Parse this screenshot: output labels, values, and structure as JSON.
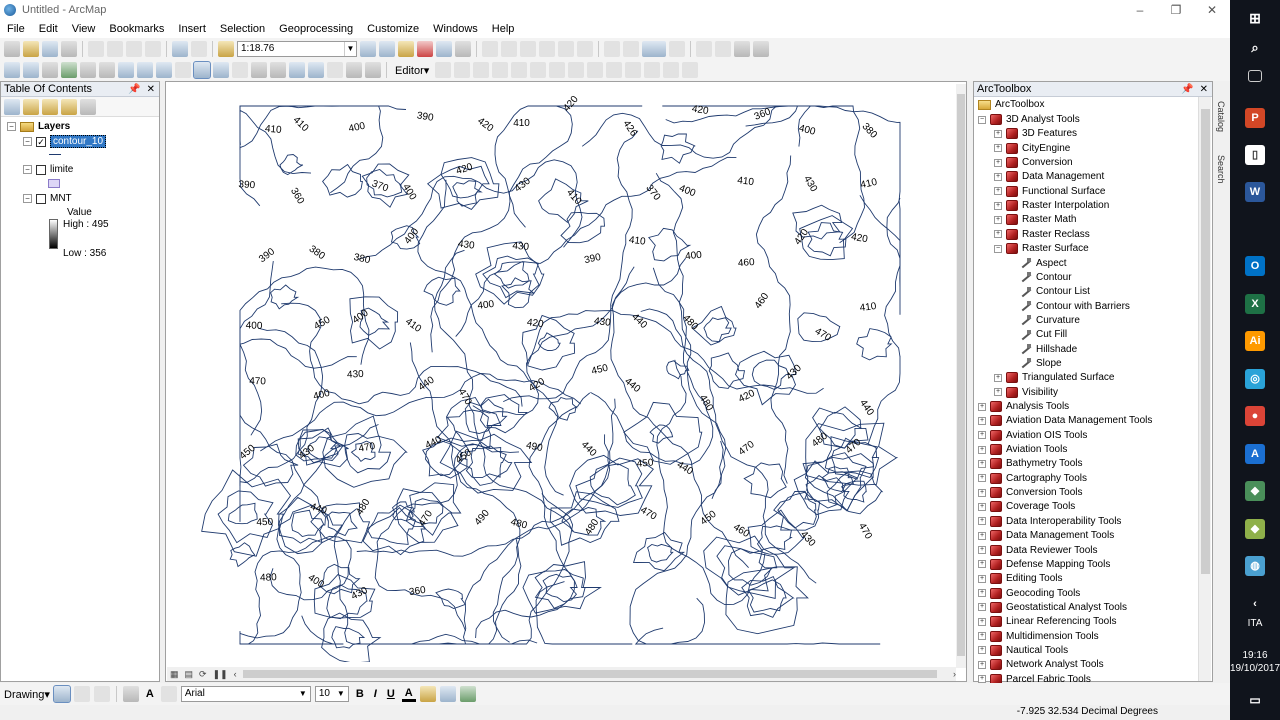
{
  "window": {
    "title": "Untitled - ArcMap",
    "minimize": "–",
    "maximize": "❐",
    "close": "✕"
  },
  "menu": [
    "File",
    "Edit",
    "View",
    "Bookmarks",
    "Insert",
    "Selection",
    "Geoprocessing",
    "Customize",
    "Windows",
    "Help"
  ],
  "toolbar": {
    "scale": "1:18.76",
    "editor_label": "Editor▾"
  },
  "toc": {
    "title": "Table Of Contents",
    "layers_label": "Layers",
    "items": [
      {
        "name": "contour_10",
        "checked": true
      },
      {
        "name": "limite",
        "checked": false
      },
      {
        "name": "MNT",
        "checked": false
      }
    ],
    "mnt_value_label": "Value",
    "mnt_high": "High : 495",
    "mnt_low": "Low : 356"
  },
  "map": {
    "contour_color": "#1f3a6e",
    "labels": [
      "410",
      "410",
      "400",
      "390",
      "420",
      "410",
      "420",
      "426",
      "420",
      "360",
      "400",
      "380",
      "390",
      "360",
      "370",
      "400",
      "420",
      "430",
      "410",
      "370",
      "400",
      "410",
      "430",
      "410",
      "390",
      "380",
      "380",
      "400",
      "430",
      "430",
      "390",
      "410",
      "400",
      "460",
      "420",
      "420",
      "400",
      "450",
      "400",
      "410",
      "400",
      "420",
      "430",
      "440",
      "480",
      "460",
      "470",
      "410",
      "470",
      "400",
      "430",
      "440",
      "470",
      "420",
      "450",
      "440",
      "480",
      "420",
      "430",
      "440",
      "450",
      "430",
      "470",
      "440",
      "450",
      "490",
      "440",
      "450",
      "440",
      "470",
      "480",
      "470",
      "450",
      "440",
      "480",
      "470",
      "490",
      "480",
      "480",
      "470",
      "450",
      "460",
      "430",
      "470",
      "480",
      "400",
      "430",
      "360"
    ]
  },
  "toolbox": {
    "title": "ArcToolbox",
    "root": "ArcToolbox",
    "items": [
      {
        "label": "3D Analyst Tools",
        "level": 1,
        "kind": "toolbox",
        "expanded": true
      },
      {
        "label": "3D Features",
        "level": 2,
        "kind": "toolbox",
        "expanded": false
      },
      {
        "label": "CityEngine",
        "level": 2,
        "kind": "toolbox",
        "expanded": false
      },
      {
        "label": "Conversion",
        "level": 2,
        "kind": "toolbox",
        "expanded": false
      },
      {
        "label": "Data Management",
        "level": 2,
        "kind": "toolbox",
        "expanded": false
      },
      {
        "label": "Functional Surface",
        "level": 2,
        "kind": "toolbox",
        "expanded": false
      },
      {
        "label": "Raster Interpolation",
        "level": 2,
        "kind": "toolbox",
        "expanded": false
      },
      {
        "label": "Raster Math",
        "level": 2,
        "kind": "toolbox",
        "expanded": false
      },
      {
        "label": "Raster Reclass",
        "level": 2,
        "kind": "toolbox",
        "expanded": false
      },
      {
        "label": "Raster Surface",
        "level": 2,
        "kind": "toolbox",
        "expanded": true
      },
      {
        "label": "Aspect",
        "level": 3,
        "kind": "tool"
      },
      {
        "label": "Contour",
        "level": 3,
        "kind": "tool"
      },
      {
        "label": "Contour List",
        "level": 3,
        "kind": "tool"
      },
      {
        "label": "Contour with Barriers",
        "level": 3,
        "kind": "tool"
      },
      {
        "label": "Curvature",
        "level": 3,
        "kind": "tool"
      },
      {
        "label": "Cut Fill",
        "level": 3,
        "kind": "tool"
      },
      {
        "label": "Hillshade",
        "level": 3,
        "kind": "tool"
      },
      {
        "label": "Slope",
        "level": 3,
        "kind": "tool"
      },
      {
        "label": "Triangulated Surface",
        "level": 2,
        "kind": "toolbox",
        "expanded": false
      },
      {
        "label": "Visibility",
        "level": 2,
        "kind": "toolbox",
        "expanded": false
      },
      {
        "label": "Analysis Tools",
        "level": 1,
        "kind": "toolbox",
        "expanded": false
      },
      {
        "label": "Aviation Data Management Tools",
        "level": 1,
        "kind": "toolbox",
        "expanded": false
      },
      {
        "label": "Aviation OIS Tools",
        "level": 1,
        "kind": "toolbox",
        "expanded": false
      },
      {
        "label": "Aviation Tools",
        "level": 1,
        "kind": "toolbox",
        "expanded": false
      },
      {
        "label": "Bathymetry Tools",
        "level": 1,
        "kind": "toolbox",
        "expanded": false
      },
      {
        "label": "Cartography Tools",
        "level": 1,
        "kind": "toolbox",
        "expanded": false
      },
      {
        "label": "Conversion Tools",
        "level": 1,
        "kind": "toolbox",
        "expanded": false
      },
      {
        "label": "Coverage Tools",
        "level": 1,
        "kind": "toolbox",
        "expanded": false
      },
      {
        "label": "Data Interoperability Tools",
        "level": 1,
        "kind": "toolbox",
        "expanded": false
      },
      {
        "label": "Data Management Tools",
        "level": 1,
        "kind": "toolbox",
        "expanded": false
      },
      {
        "label": "Data Reviewer Tools",
        "level": 1,
        "kind": "toolbox",
        "expanded": false
      },
      {
        "label": "Defense Mapping Tools",
        "level": 1,
        "kind": "toolbox",
        "expanded": false
      },
      {
        "label": "Editing Tools",
        "level": 1,
        "kind": "toolbox",
        "expanded": false
      },
      {
        "label": "Geocoding Tools",
        "level": 1,
        "kind": "toolbox",
        "expanded": false
      },
      {
        "label": "Geostatistical Analyst Tools",
        "level": 1,
        "kind": "toolbox",
        "expanded": false
      },
      {
        "label": "Linear Referencing Tools",
        "level": 1,
        "kind": "toolbox",
        "expanded": false
      },
      {
        "label": "Multidimension Tools",
        "level": 1,
        "kind": "toolbox",
        "expanded": false
      },
      {
        "label": "Nautical Tools",
        "level": 1,
        "kind": "toolbox",
        "expanded": false
      },
      {
        "label": "Network Analyst Tools",
        "level": 1,
        "kind": "toolbox",
        "expanded": false
      },
      {
        "label": "Parcel Fabric Tools",
        "level": 1,
        "kind": "toolbox",
        "expanded": false
      }
    ]
  },
  "side_tabs": {
    "catalog": "Catalog",
    "search": "Search"
  },
  "drawing": {
    "label": "Drawing▾",
    "font": "Arial",
    "size": "10",
    "bold": "B",
    "italic": "I",
    "underline": "U",
    "text_tool": "A"
  },
  "status": {
    "coords": "-7.925  32.534 Decimal Degrees"
  },
  "taskbar": {
    "lang": "ITA",
    "time": "19:16",
    "date": "19/10/2017",
    "apps": [
      {
        "name": "outlook-icon",
        "glyph": "O",
        "color": "#0072c6"
      },
      {
        "name": "excel-icon",
        "glyph": "X",
        "color": "#1e7145"
      },
      {
        "name": "illustrator-icon",
        "glyph": "Ai",
        "color": "#ff9a00"
      },
      {
        "name": "app-icon",
        "glyph": "◎",
        "color": "#2aa3d8"
      },
      {
        "name": "chrome-icon",
        "glyph": "●",
        "color": "#db4437"
      },
      {
        "name": "app-a-icon",
        "glyph": "A",
        "color": "#1b6fd1"
      },
      {
        "name": "arcgis-icon",
        "glyph": "◆",
        "color": "#4a8f5a"
      },
      {
        "name": "arcgis2-icon",
        "glyph": "◆",
        "color": "#8fb04a"
      },
      {
        "name": "arcmap-icon",
        "glyph": "◍",
        "color": "#4aa0d0"
      }
    ],
    "pinned": [
      {
        "name": "powerpoint-icon",
        "glyph": "P",
        "color": "#d24726"
      },
      {
        "name": "document-icon",
        "glyph": "▯",
        "color": "#ffffff"
      },
      {
        "name": "word-icon",
        "glyph": "W",
        "color": "#2b579a"
      }
    ]
  }
}
